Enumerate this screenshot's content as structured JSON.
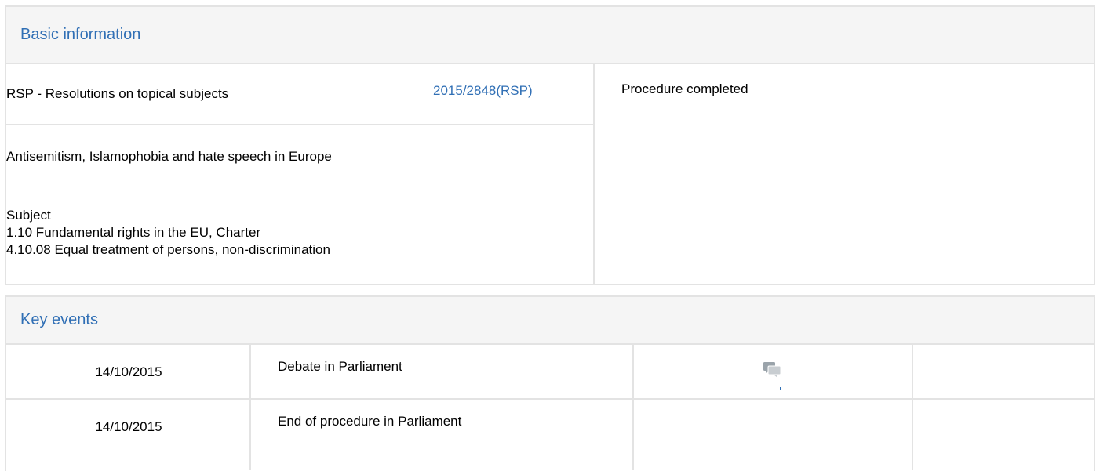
{
  "basic_information": {
    "heading": "Basic information",
    "procedure_type": "RSP - Resolutions on topical subjects",
    "procedure_reference": "2015/2848(RSP)",
    "status": "Procedure completed",
    "title": "Antisemitism, Islamophobia and hate speech in Europe",
    "subject_heading": "Subject",
    "subjects": [
      "1.10 Fundamental rights in the EU, Charter",
      "4.10.08 Equal treatment of persons, non-discrimination"
    ]
  },
  "key_events": {
    "heading": "Key events",
    "rows": [
      {
        "date": "14/10/2015",
        "event": "Debate in Parliament",
        "document_icon": "debate-speech-bubbles-icon"
      },
      {
        "date": "14/10/2015",
        "event": "End of procedure in Parliament"
      }
    ]
  },
  "colors": {
    "accent": "#306fb5",
    "border": "#e3e3e3",
    "header_bg": "#f5f5f5"
  }
}
